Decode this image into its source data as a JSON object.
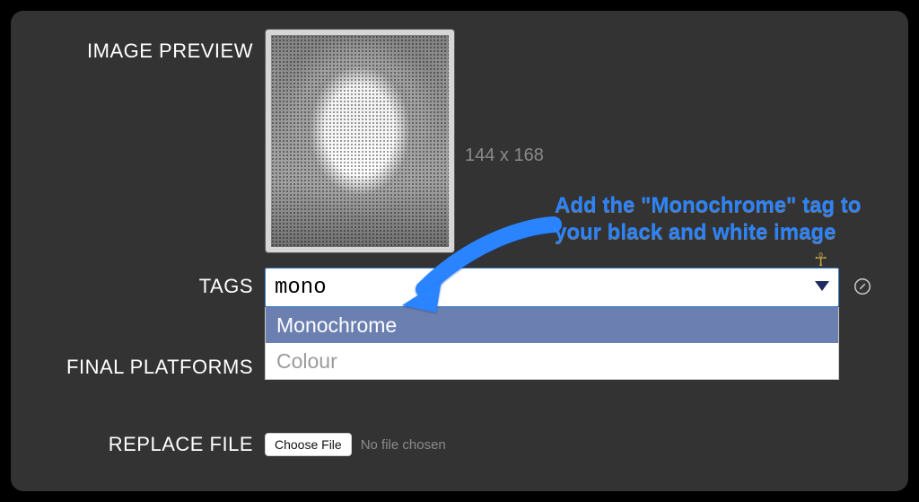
{
  "labels": {
    "image_preview": "IMAGE PREVIEW",
    "tags": "TAGS",
    "final_platforms": "FINAL PLATFORMS",
    "replace_file": "REPLACE FILE"
  },
  "preview": {
    "dimensions": "144 x 168"
  },
  "tags": {
    "input_value": "mono",
    "options": [
      "Monochrome",
      "Colour"
    ],
    "selected_index": 0
  },
  "file": {
    "button": "Choose File",
    "status": "No file chosen"
  },
  "annotation": {
    "text": "Add the \"Monochrome\" tag to your black and white image"
  }
}
